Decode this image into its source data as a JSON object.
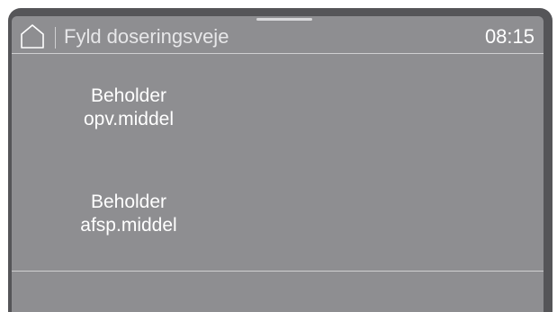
{
  "header": {
    "title": "Fyld doseringsveje",
    "time": "08:15",
    "home_icon": "home-icon"
  },
  "menu": {
    "items": [
      {
        "line1": "Beholder",
        "line2": "opv.middel"
      },
      {
        "line1": "Beholder",
        "line2": "afsp.middel"
      }
    ]
  },
  "colors": {
    "screen_bg": "#8e8e91",
    "bezel": "#555558",
    "text": "#ffffff",
    "rule": "#cfcfd1"
  }
}
